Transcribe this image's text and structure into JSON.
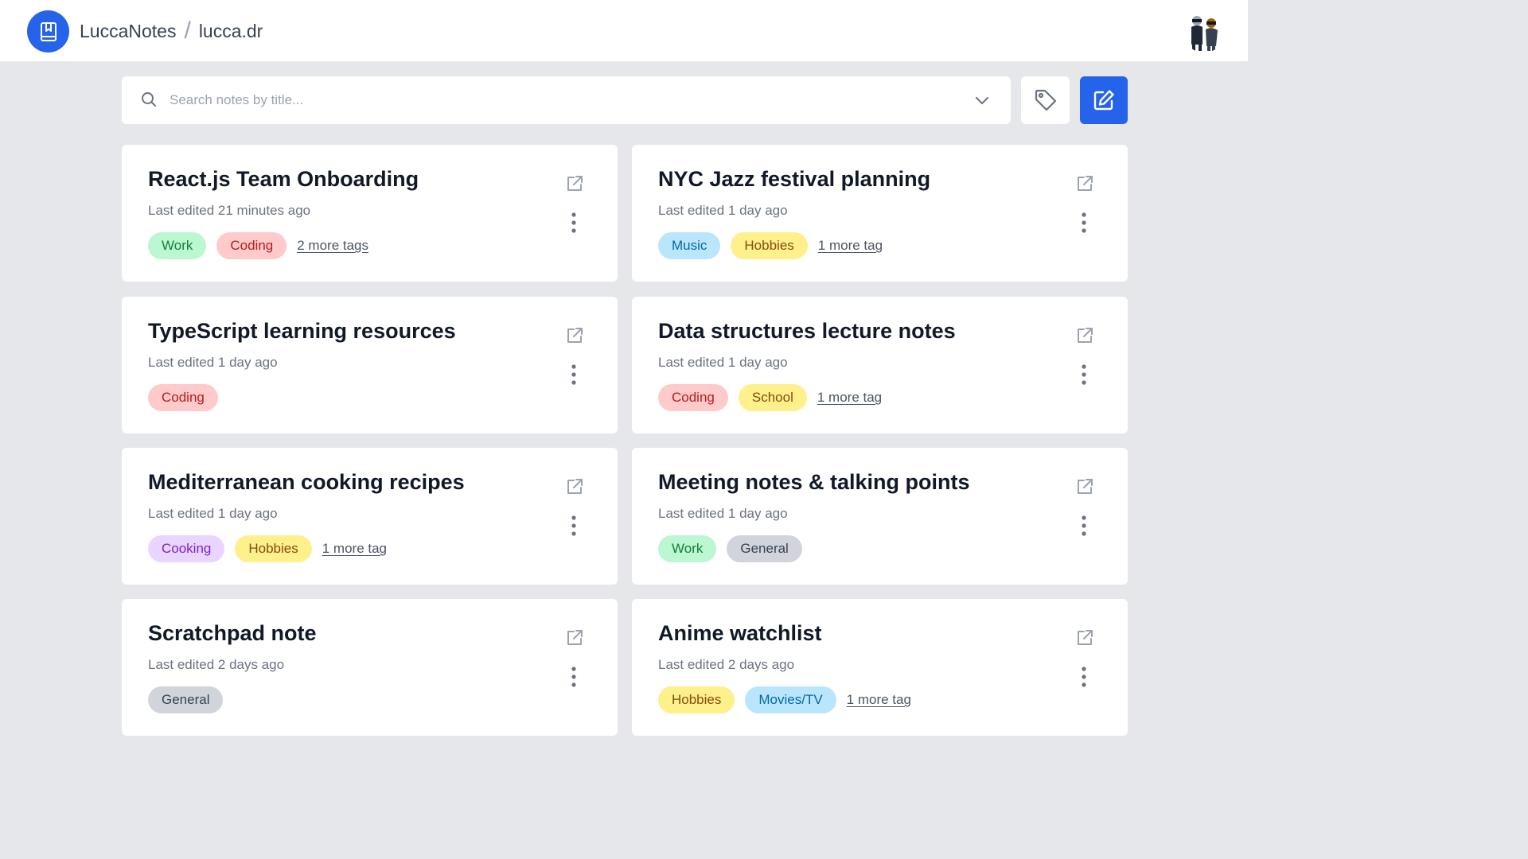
{
  "header": {
    "app_name": "LuccaNotes",
    "separator": "/",
    "username": "lucca.dr"
  },
  "search": {
    "placeholder": "Search notes by title...",
    "value": ""
  },
  "colors": {
    "accent": "#2563eb",
    "tag_work_bg": "#bbf7d0",
    "tag_work_fg": "#15803d",
    "tag_coding_bg": "#fecaca",
    "tag_coding_fg": "#b91c1c",
    "tag_music_bg": "#bae6fd",
    "tag_music_fg": "#0369a1",
    "tag_hobbies_bg": "#fef08a",
    "tag_hobbies_fg": "#854d0e",
    "tag_school_bg": "#fef08a",
    "tag_school_fg": "#854d0e",
    "tag_cooking_bg": "#e9d5ff",
    "tag_cooking_fg": "#7e22ce",
    "tag_general_bg": "#d1d5db",
    "tag_general_fg": "#374151",
    "tag_movies_bg": "#bae6fd",
    "tag_movies_fg": "#0369a1"
  },
  "icons": {
    "logo": "bookmark-book-icon",
    "search": "search-icon",
    "dropdown": "chevron-down-icon",
    "tags": "tag-icon",
    "new_note": "edit-note-icon",
    "open": "external-link-icon",
    "menu": "more-vertical-icon"
  },
  "notes": [
    {
      "title": "React.js Team Onboarding",
      "edited": "Last edited 21 minutes ago",
      "tags": [
        {
          "label": "Work",
          "kind": "work"
        },
        {
          "label": "Coding",
          "kind": "coding"
        }
      ],
      "more": "2 more tags"
    },
    {
      "title": "NYC Jazz festival planning",
      "edited": "Last edited 1 day ago",
      "tags": [
        {
          "label": "Music",
          "kind": "music"
        },
        {
          "label": "Hobbies",
          "kind": "hobbies"
        }
      ],
      "more": "1 more tag"
    },
    {
      "title": "TypeScript learning resources",
      "edited": "Last edited 1 day ago",
      "tags": [
        {
          "label": "Coding",
          "kind": "coding"
        }
      ],
      "more": ""
    },
    {
      "title": "Data structures lecture notes",
      "edited": "Last edited 1 day ago",
      "tags": [
        {
          "label": "Coding",
          "kind": "coding"
        },
        {
          "label": "School",
          "kind": "school"
        }
      ],
      "more": "1 more tag"
    },
    {
      "title": "Mediterranean cooking recipes",
      "edited": "Last edited 1 day ago",
      "tags": [
        {
          "label": "Cooking",
          "kind": "cooking"
        },
        {
          "label": "Hobbies",
          "kind": "hobbies"
        }
      ],
      "more": "1 more tag"
    },
    {
      "title": "Meeting notes & talking points",
      "edited": "Last edited 1 day ago",
      "tags": [
        {
          "label": "Work",
          "kind": "work"
        },
        {
          "label": "General",
          "kind": "general"
        }
      ],
      "more": ""
    },
    {
      "title": "Scratchpad note",
      "edited": "Last edited 2 days ago",
      "tags": [
        {
          "label": "General",
          "kind": "general"
        }
      ],
      "more": ""
    },
    {
      "title": "Anime watchlist",
      "edited": "Last edited 2 days ago",
      "tags": [
        {
          "label": "Hobbies",
          "kind": "hobbies"
        },
        {
          "label": "Movies/TV",
          "kind": "movies"
        }
      ],
      "more": "1 more tag"
    }
  ]
}
